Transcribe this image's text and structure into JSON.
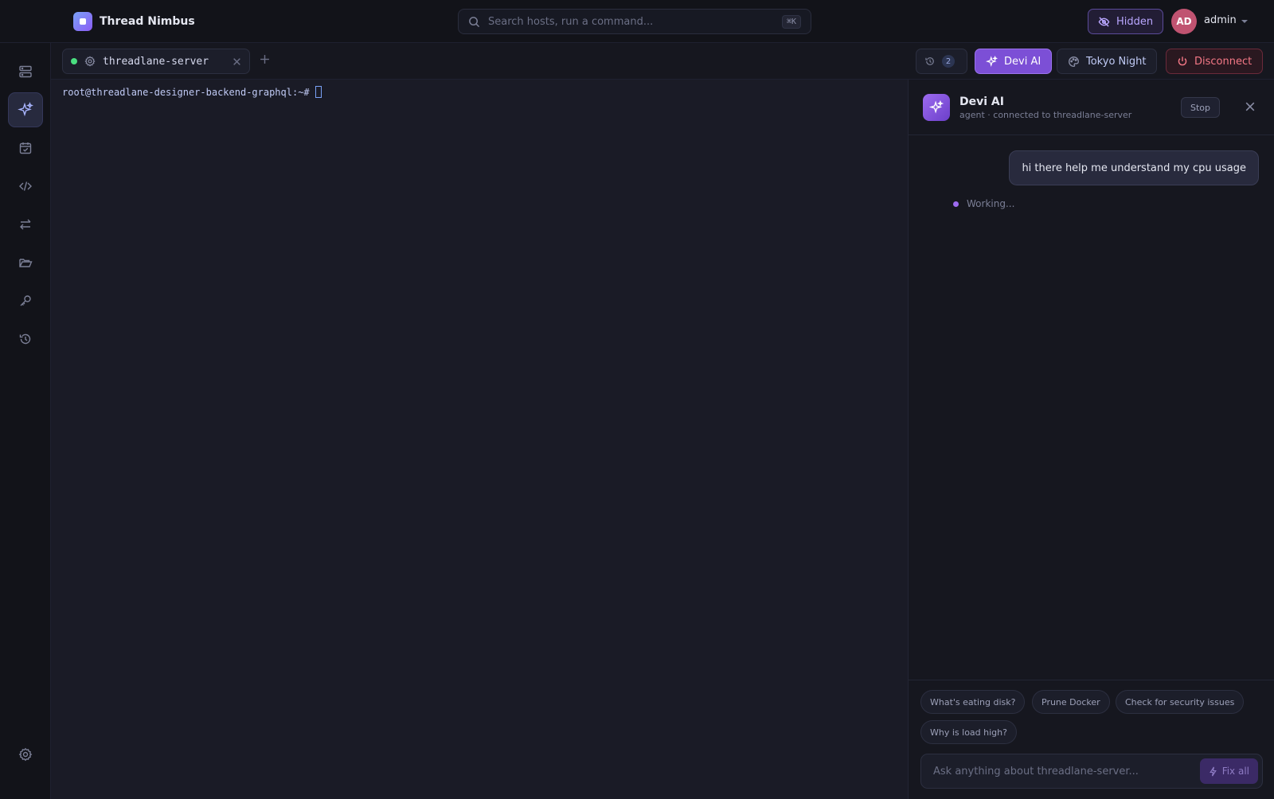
{
  "app": {
    "name": "Thread Nimbus"
  },
  "search": {
    "placeholder": "Search hosts, run a command...",
    "shortcut": "⌘K"
  },
  "header": {
    "visibility_label": "Hidden",
    "user_initials": "AD",
    "user_name": "admin"
  },
  "sidebar": {
    "items": [
      {
        "icon": "server-icon"
      },
      {
        "icon": "sparkle-icon",
        "active": true
      },
      {
        "icon": "calendar-check-icon"
      },
      {
        "icon": "code-icon"
      },
      {
        "icon": "transfer-icon"
      },
      {
        "icon": "folder-icon"
      },
      {
        "icon": "key-icon"
      },
      {
        "icon": "history-icon"
      }
    ],
    "bottom_icon": "settings-icon"
  },
  "tabs": [
    {
      "label": "threadlane-server",
      "status": "connected",
      "status_color": "#4ade80"
    }
  ],
  "toolbar": {
    "history_count": "2",
    "ai_label": "Devi AI",
    "theme_label": "Tokyo Night",
    "disconnect_label": "Disconnect"
  },
  "terminal": {
    "prompt": "root@threadlane-designer-backend-graphql:~#"
  },
  "ai_panel": {
    "title": "Devi AI",
    "subtitle": "agent · connected to threadlane-server",
    "stop_label": "Stop",
    "messages": [
      {
        "role": "user",
        "text": "hi there help me understand my cpu usage"
      }
    ],
    "status": "Working...",
    "suggestions": [
      "What's eating disk?",
      "Prune Docker",
      "Check for security issues",
      "Why is load high?"
    ],
    "input_placeholder": "Ask anything about threadlane-server...",
    "fix_label": "Fix all"
  },
  "colors": {
    "accent": "#7c4fd6",
    "background": "#1a1b26",
    "danger": "#f47886"
  }
}
